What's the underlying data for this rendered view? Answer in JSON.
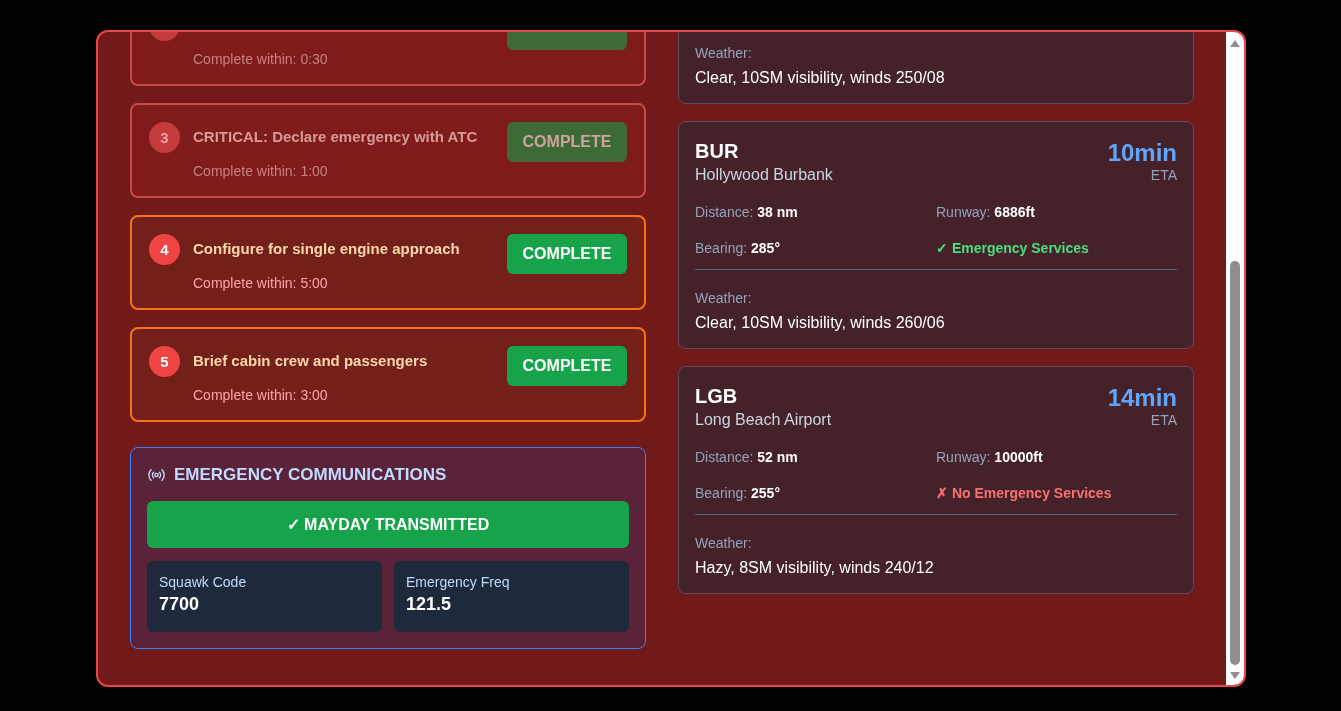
{
  "checklist": [
    {
      "time": "Complete within: 0:30",
      "done": true
    },
    {
      "number": "3",
      "title": "CRITICAL: Declare emergency with ATC",
      "time": "Complete within: 1:00",
      "button": "COMPLETE",
      "done": true
    },
    {
      "number": "4",
      "title": "Configure for single engine approach",
      "time": "Complete within: 5:00",
      "button": "COMPLETE",
      "done": false
    },
    {
      "number": "5",
      "title": "Brief cabin crew and passengers",
      "time": "Complete within: 3:00",
      "button": "COMPLETE",
      "done": false
    }
  ],
  "communications": {
    "title": "EMERGENCY COMMUNICATIONS",
    "mayday_button": "✓ MAYDAY TRANSMITTED",
    "fields": [
      {
        "label": "Squawk Code",
        "value": "7700"
      },
      {
        "label": "Emergency Freq",
        "value": "121.5"
      }
    ]
  },
  "airports": [
    {
      "weather_label": "Weather:",
      "weather": "Clear, 10SM visibility, winds 250/08"
    },
    {
      "code": "BUR",
      "name": "Hollywood Burbank",
      "eta": "10min",
      "eta_label": "ETA",
      "distance_label": "Distance:",
      "distance": "38 nm",
      "runway_label": "Runway:",
      "runway": "6886ft",
      "bearing_label": "Bearing:",
      "bearing": "285°",
      "emergency_services": true,
      "services": "✓ Emergency Services",
      "weather_label": "Weather:",
      "weather": "Clear, 10SM visibility, winds 260/06"
    },
    {
      "code": "LGB",
      "name": "Long Beach Airport",
      "eta": "14min",
      "eta_label": "ETA",
      "distance_label": "Distance:",
      "distance": "52 nm",
      "runway_label": "Runway:",
      "runway": "10000ft",
      "bearing_label": "Bearing:",
      "bearing": "255°",
      "emergency_services": false,
      "services": "✗ No Emergency Services",
      "weather_label": "Weather:",
      "weather": "Hazy, 8SM visibility, winds 240/12"
    }
  ]
}
